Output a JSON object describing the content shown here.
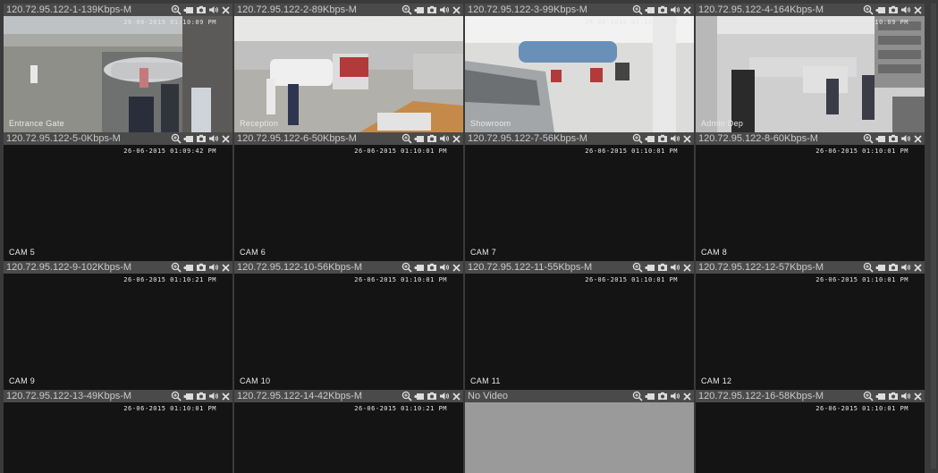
{
  "colors": {
    "selected_border": "#3fc94a",
    "title_bar": "#4a4a4a",
    "video_bg": "#141414",
    "no_video_bg": "#9a9a9a"
  },
  "tile_icons": [
    "zoom-in-icon",
    "record-icon",
    "snapshot-icon",
    "speaker-icon",
    "close-icon"
  ],
  "tiles": [
    {
      "title": "120.72.95.122-1-139Kbps-M",
      "timestamp": "26-06-2015 01:10:09 PM",
      "camera": "Entrance Gate",
      "scene": "entrance"
    },
    {
      "title": "120.72.95.122-2-89Kbps-M",
      "timestamp": "26-06-2015 01:10:09 PM",
      "camera": "Reception",
      "scene": "reception"
    },
    {
      "title": "120.72.95.122-3-99Kbps-M",
      "timestamp": "26-06-2015 01:10:09 PM",
      "camera": "Showroom",
      "scene": "showroom"
    },
    {
      "title": "120.72.95.122-4-164Kbps-M",
      "timestamp": "26-06-2015 01:10:09 PM",
      "camera": "Admin Dep",
      "scene": "admin"
    },
    {
      "title": "120.72.95.122-5-0Kbps-M",
      "timestamp": "26-06-2015 01:09:42 PM",
      "camera": "CAM 5",
      "scene": "dark"
    },
    {
      "title": "120.72.95.122-6-50Kbps-M",
      "timestamp": "26-06-2015 01:10:01 PM",
      "camera": "CAM 6",
      "scene": "dark"
    },
    {
      "title": "120.72.95.122-7-56Kbps-M",
      "timestamp": "26-06-2015 01:10:01 PM",
      "camera": "CAM 7",
      "scene": "dark"
    },
    {
      "title": "120.72.95.122-8-60Kbps-M",
      "timestamp": "26-06-2015 01:10:01 PM",
      "camera": "CAM 8",
      "scene": "dark"
    },
    {
      "title": "120.72.95.122-9-102Kbps-M",
      "timestamp": "26-06-2015 01:10:21 PM",
      "camera": "CAM 9",
      "scene": "dark"
    },
    {
      "title": "120.72.95.122-10-56Kbps-M",
      "timestamp": "26-06-2015 01:10:01 PM",
      "camera": "CAM 10",
      "scene": "dark"
    },
    {
      "title": "120.72.95.122-11-55Kbps-M",
      "timestamp": "26-06-2015 01:10:01 PM",
      "camera": "CAM 11",
      "scene": "dark"
    },
    {
      "title": "120.72.95.122-12-57Kbps-M",
      "timestamp": "26-06-2015 01:10:01 PM",
      "camera": "CAM 12",
      "scene": "dark"
    },
    {
      "title": "120.72.95.122-13-49Kbps-M",
      "timestamp": "26-06-2015 01:10:01 PM",
      "camera": "",
      "scene": "dark"
    },
    {
      "title": "120.72.95.122-14-42Kbps-M",
      "timestamp": "26-06-2015 01:10:21 PM",
      "camera": "",
      "scene": "dark"
    },
    {
      "title": "No Video",
      "timestamp": "",
      "camera": "",
      "scene": "novideo"
    },
    {
      "title": "120.72.95.122-16-58Kbps-M",
      "timestamp": "26-06-2015 01:10:01 PM",
      "camera": "",
      "scene": "dark"
    }
  ]
}
